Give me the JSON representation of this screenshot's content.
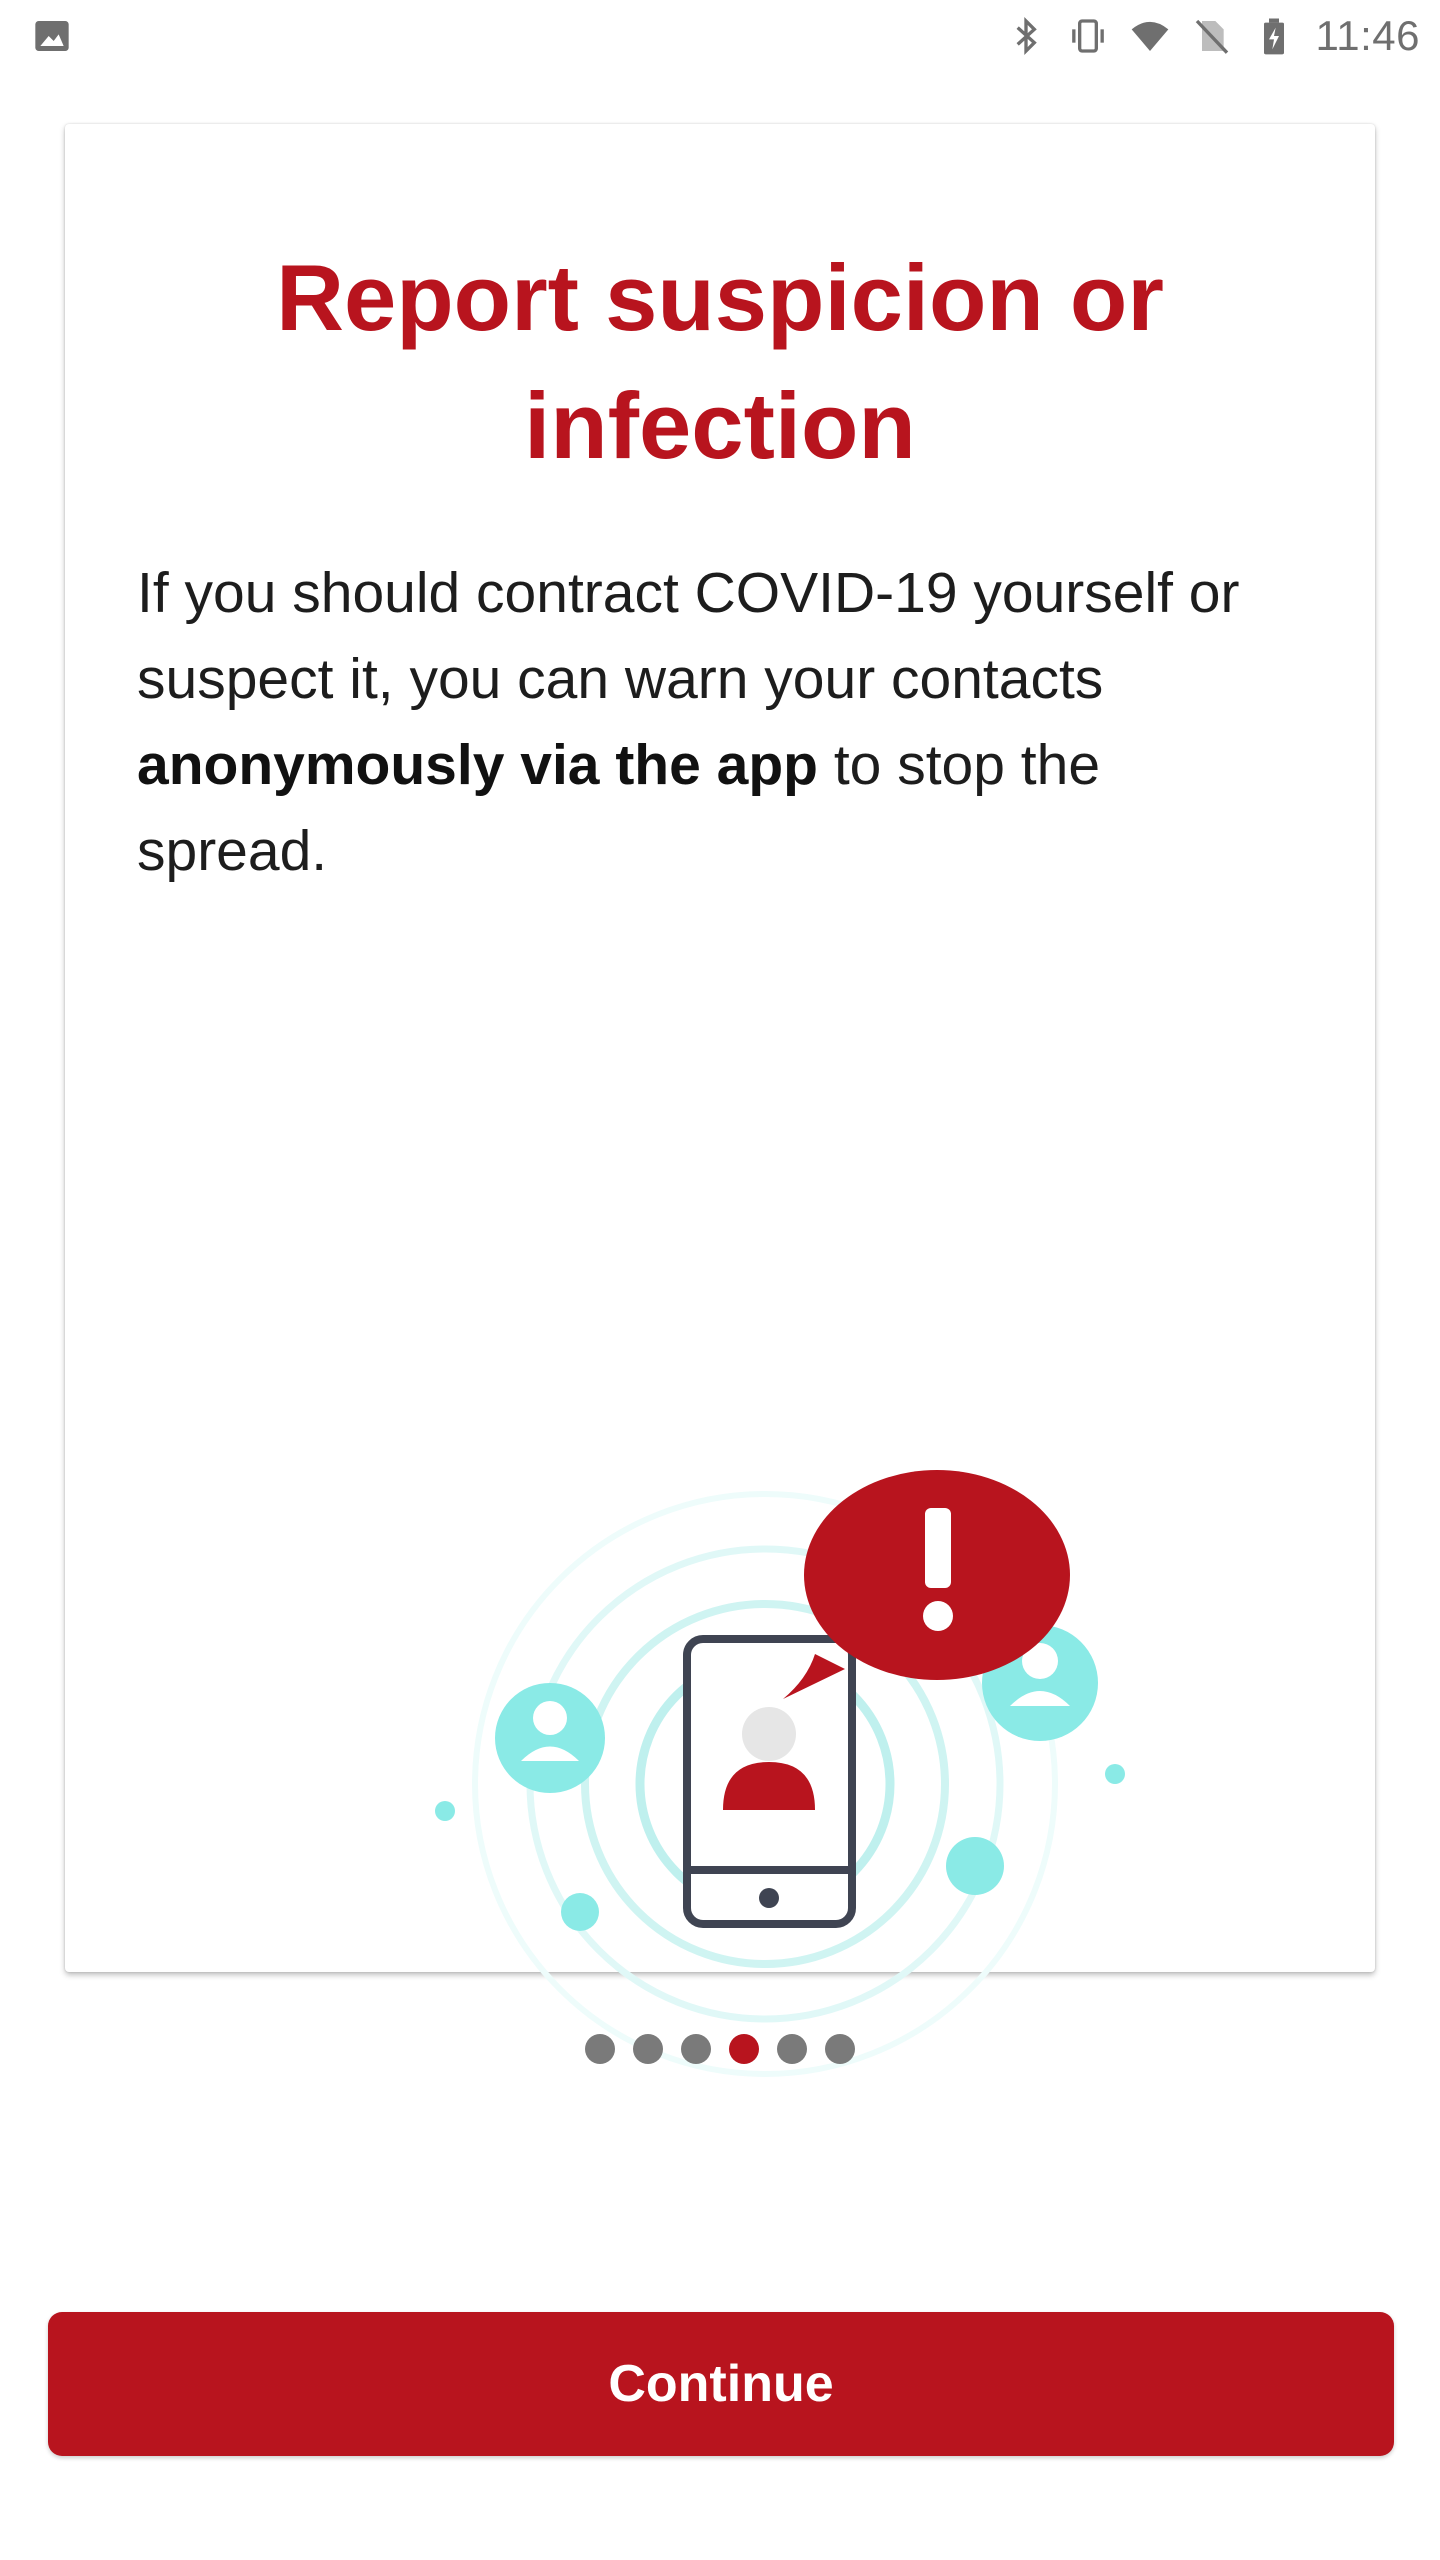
{
  "status_bar": {
    "time": "11:46",
    "icons": [
      "image-icon",
      "bluetooth-icon",
      "vibrate-icon",
      "wifi-icon",
      "no-sim-icon",
      "battery-charging-icon"
    ]
  },
  "card": {
    "title": "Report suspicion or infection",
    "body_pre": "If you should contract COVID-19 yourself or suspect it, you can warn your contacts ",
    "body_bold": "anonymously via the app",
    "body_post": " to stop the spread."
  },
  "pager": {
    "total": 6,
    "active_index": 3
  },
  "footer": {
    "continue_label": "Continue"
  },
  "colors": {
    "accent": "#b8141e",
    "teal": "#8aeae6",
    "dot_inactive": "#7a7a7a"
  }
}
